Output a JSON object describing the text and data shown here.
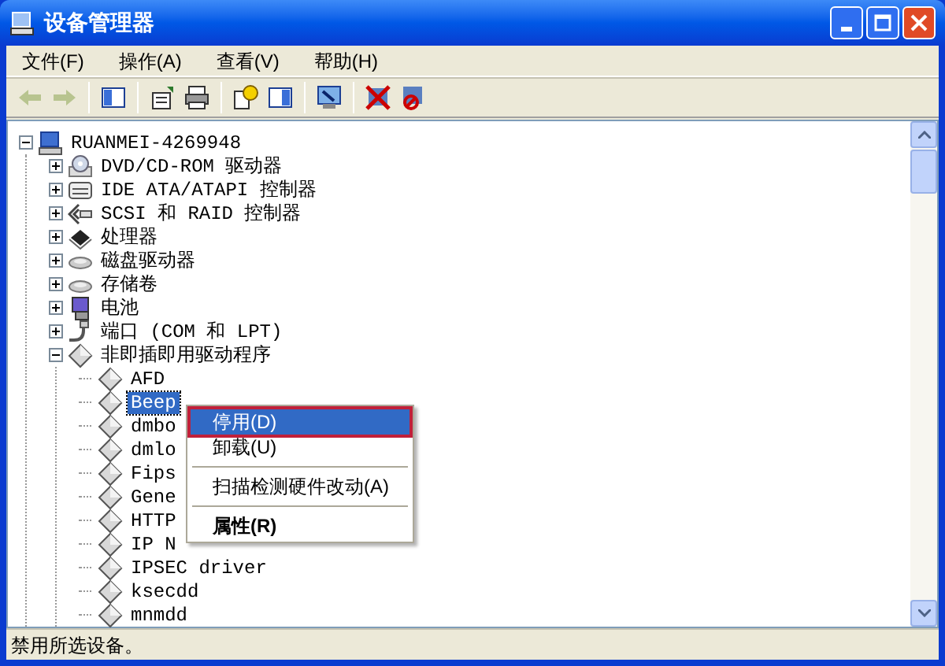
{
  "window": {
    "title": "设备管理器"
  },
  "menu": [
    "文件(F)",
    "操作(A)",
    "查看(V)",
    "帮助(H)"
  ],
  "toolbar": [
    {
      "kind": "back",
      "disabled": true
    },
    {
      "kind": "forward",
      "disabled": true
    },
    {
      "kind": "sep"
    },
    {
      "kind": "tree",
      "disabled": false
    },
    {
      "kind": "sep"
    },
    {
      "kind": "properties",
      "disabled": false
    },
    {
      "kind": "print",
      "disabled": false
    },
    {
      "kind": "sep"
    },
    {
      "kind": "help",
      "disabled": false
    },
    {
      "kind": "pane",
      "disabled": false
    },
    {
      "kind": "sep"
    },
    {
      "kind": "scan",
      "disabled": false
    },
    {
      "kind": "sep"
    },
    {
      "kind": "uninstall",
      "disabled": false
    },
    {
      "kind": "disable",
      "disabled": false
    }
  ],
  "tree": [
    {
      "label": "RUANMEI-4269948",
      "kind": "computer",
      "expanded": true,
      "selected": false,
      "children": [
        {
          "label": "DVD/CD-ROM 驱动器",
          "kind": "dvd",
          "expanded": false,
          "selected": false
        },
        {
          "label": "IDE ATA/ATAPI 控制器",
          "kind": "ide",
          "expanded": false,
          "selected": false
        },
        {
          "label": "SCSI 和 RAID 控制器",
          "kind": "scsi",
          "expanded": false,
          "selected": false
        },
        {
          "label": "处理器",
          "kind": "cpu",
          "expanded": false,
          "selected": false
        },
        {
          "label": "磁盘驱动器",
          "kind": "disk",
          "expanded": false,
          "selected": false
        },
        {
          "label": "存储卷",
          "kind": "disk",
          "expanded": false,
          "selected": false
        },
        {
          "label": "电池",
          "kind": "battery",
          "expanded": false,
          "selected": false
        },
        {
          "label": "端口 (COM 和 LPT)",
          "kind": "port",
          "expanded": false,
          "selected": false
        },
        {
          "label": "非即插即用驱动程序",
          "kind": "driver",
          "expanded": true,
          "selected": false,
          "children": [
            {
              "label": "AFD",
              "kind": "driver",
              "selected": false
            },
            {
              "label": "Beep",
              "kind": "driver",
              "selected": true
            },
            {
              "label": "dmbo",
              "kind": "driver",
              "selected": false
            },
            {
              "label": "dmlo",
              "kind": "driver",
              "selected": false
            },
            {
              "label": "Fips",
              "kind": "driver",
              "selected": false
            },
            {
              "label": "Gene",
              "kind": "driver",
              "selected": false
            },
            {
              "label": "HTTP",
              "kind": "driver",
              "selected": false
            },
            {
              "label": "IP N",
              "kind": "driver",
              "selected": false
            },
            {
              "label": "IPSEC driver",
              "kind": "driver",
              "selected": false
            },
            {
              "label": "ksecdd",
              "kind": "driver",
              "selected": false
            },
            {
              "label": "mnmdd",
              "kind": "driver",
              "selected": false
            }
          ]
        }
      ]
    }
  ],
  "context_menu": [
    {
      "kind": "item",
      "label": "停用(D)",
      "selected": true,
      "bold": false
    },
    {
      "kind": "item",
      "label": "卸载(U)",
      "selected": false,
      "bold": false
    },
    {
      "kind": "separator"
    },
    {
      "kind": "item",
      "label": "扫描检测硬件改动(A)",
      "selected": false,
      "bold": false
    },
    {
      "kind": "separator"
    },
    {
      "kind": "item",
      "label": "属性(R)",
      "selected": false,
      "bold": true
    }
  ],
  "status_bar": "禁用所选设备。"
}
